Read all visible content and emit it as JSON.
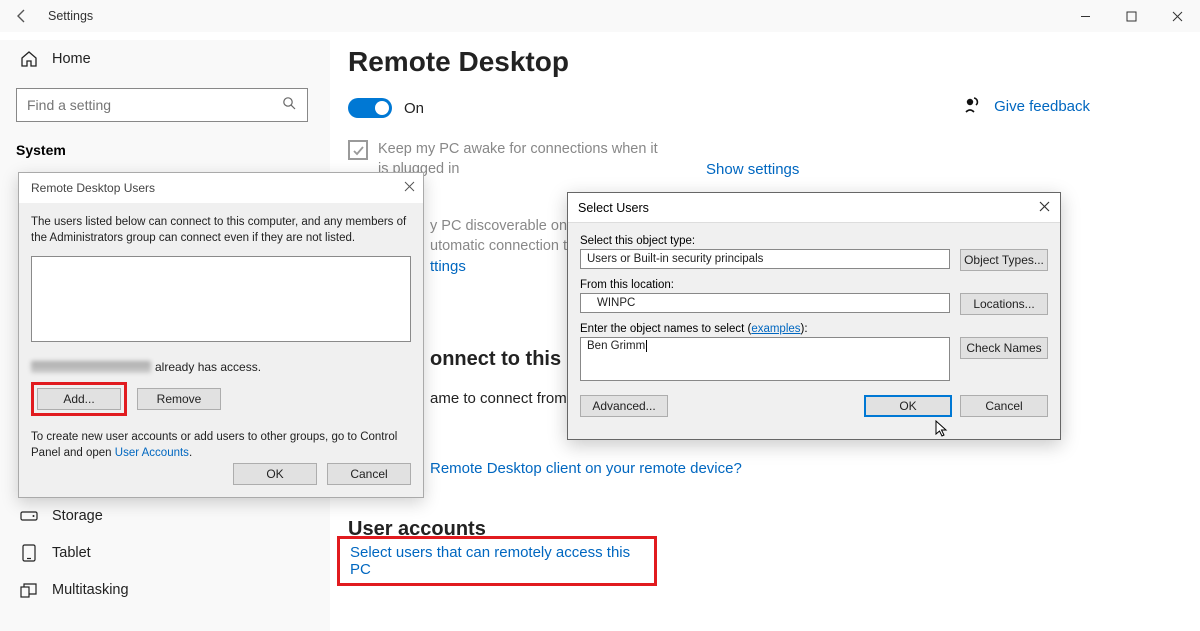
{
  "titlebar": {
    "title": "Settings"
  },
  "sidebar": {
    "home": "Home",
    "search_placeholder": "Find a setting",
    "heading": "System",
    "items": [
      {
        "label": "Storage"
      },
      {
        "label": "Tablet"
      },
      {
        "label": "Multitasking"
      }
    ]
  },
  "main": {
    "heading": "Remote Desktop",
    "toggle_label": "On",
    "feedback_label": "Give feedback",
    "keep_awake": "Keep my PC awake for connections when it is plugged in",
    "show_settings1": "Show settings",
    "discoverable_prefix": "y PC discoverable on p",
    "automatic_prefix": "utomatic connection t",
    "ttings_link": "ttings",
    "connect_heading_prefix": "onnect to this P",
    "use_name_prefix": "ame to connect from",
    "remote_device_prefix": "Remote Desktop client on your remote device?",
    "accounts_heading": "User accounts",
    "select_users_link": "Select users that can remotely access this PC"
  },
  "dlg_rdu": {
    "title": "Remote Desktop Users",
    "blurb": "The users listed below can connect to this computer, and any members of the Administrators group can connect even if they are not listed.",
    "has_access_suffix": " already has access.",
    "add": "Add...",
    "remove": "Remove",
    "hint_prefix": "To create new user accounts or add users to other groups, go to Control Panel and open ",
    "hint_link": "User Accounts",
    "ok": "OK",
    "cancel": "Cancel"
  },
  "dlg_su": {
    "title": "Select Users",
    "obj_type_lbl": "Select this object type:",
    "obj_type_val": "Users or Built-in security principals",
    "obj_types_btn": "Object Types...",
    "loc_lbl": "From this location:",
    "loc_val": "WINPC",
    "loc_btn": "Locations...",
    "names_lbl_prefix": "Enter the object names to select (",
    "names_lbl_link": "examples",
    "names_lbl_suffix": "):",
    "names_val": "Ben Grimm",
    "check_names": "Check Names",
    "advanced": "Advanced...",
    "ok": "OK",
    "cancel": "Cancel"
  }
}
